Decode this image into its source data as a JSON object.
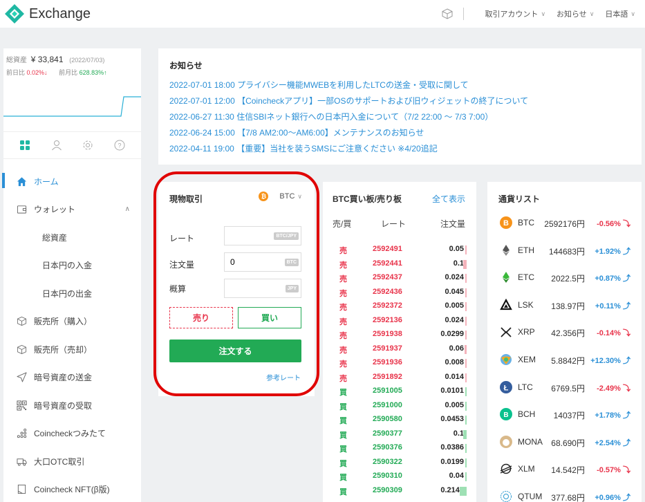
{
  "header": {
    "logo_text": "Exchange",
    "menus": [
      {
        "label": "取引アカウント"
      },
      {
        "label": "お知らせ"
      },
      {
        "label": "日本語"
      }
    ]
  },
  "sidebar": {
    "asset_label": "総資産",
    "asset_value": "¥ 33,841",
    "asset_date": "(2022/07/03)",
    "prev_day_label": "前日比",
    "prev_day_value": "0.02%↓",
    "prev_month_label": "前月比",
    "prev_month_value": "628.83%↑",
    "nav": [
      {
        "label": "ホーム",
        "icon": "home-icon"
      },
      {
        "label": "ウォレット",
        "icon": "wallet-icon"
      },
      {
        "label": "総資産"
      },
      {
        "label": "日本円の入金"
      },
      {
        "label": "日本円の出金"
      },
      {
        "label": "販売所（購入）",
        "icon": "cube-icon"
      },
      {
        "label": "販売所（売却）",
        "icon": "cube-icon"
      },
      {
        "label": "暗号資産の送金",
        "icon": "send-icon"
      },
      {
        "label": "暗号資産の受取",
        "icon": "qr-icon"
      },
      {
        "label": "Coincheckつみたて",
        "icon": "dots-icon"
      },
      {
        "label": "大口OTC取引",
        "icon": "truck-icon"
      },
      {
        "label": "Coincheck NFT(β版)",
        "icon": "nft-icon"
      }
    ]
  },
  "news": {
    "title": "お知らせ",
    "items": [
      "2022-07-01 18:00 プライバシー機能MWEBを利用したLTCの送金・受取に関して",
      "2022-07-01 12:00 【Coincheckアプリ】一部OSのサポートおよび旧ウィジェットの終了について",
      "2022-06-27 11:30 住信SBIネット銀行への日本円入金について（7/2 22:00 ～ 7/3 7:00）",
      "2022-06-24 15:00 【7/8 AM2:00～AM6:00】メンテナンスのお知らせ",
      "2022-04-11 19:00 【重要】当社を装うSMSにご注意ください ※4/20追記"
    ]
  },
  "trade": {
    "title": "現物取引",
    "coin": "BTC",
    "rate_label": "レート",
    "rate_unit": "BTC/JPY",
    "amount_label": "注文量",
    "amount_value": "0",
    "amount_unit": "BTC",
    "estimate_label": "概算",
    "estimate_unit": "JPY",
    "sell_label": "売り",
    "buy_label": "買い",
    "order_label": "注文する",
    "ref_label": "参考レート"
  },
  "book": {
    "title": "BTC買い板/売り板",
    "show_all": "全て表示",
    "col_side": "売/買",
    "col_rate": "レート",
    "col_amount": "注文量",
    "rows": [
      {
        "side": "売",
        "rate": "2592491",
        "amount": "0.05",
        "type": "ask"
      },
      {
        "side": "売",
        "rate": "2592441",
        "amount": "0.1",
        "type": "ask"
      },
      {
        "side": "売",
        "rate": "2592437",
        "amount": "0.024",
        "type": "ask"
      },
      {
        "side": "売",
        "rate": "2592436",
        "amount": "0.045",
        "type": "ask"
      },
      {
        "side": "売",
        "rate": "2592372",
        "amount": "0.005",
        "type": "ask"
      },
      {
        "side": "売",
        "rate": "2592136",
        "amount": "0.024",
        "type": "ask"
      },
      {
        "side": "売",
        "rate": "2591938",
        "amount": "0.0299",
        "type": "ask"
      },
      {
        "side": "売",
        "rate": "2591937",
        "amount": "0.06",
        "type": "ask"
      },
      {
        "side": "売",
        "rate": "2591936",
        "amount": "0.008",
        "type": "ask"
      },
      {
        "side": "売",
        "rate": "2591892",
        "amount": "0.014",
        "type": "ask"
      },
      {
        "side": "買",
        "rate": "2591005",
        "amount": "0.0101",
        "type": "bid"
      },
      {
        "side": "買",
        "rate": "2591000",
        "amount": "0.005",
        "type": "bid"
      },
      {
        "side": "買",
        "rate": "2590580",
        "amount": "0.0453",
        "type": "bid"
      },
      {
        "side": "買",
        "rate": "2590377",
        "amount": "0.1",
        "type": "bid"
      },
      {
        "side": "買",
        "rate": "2590376",
        "amount": "0.0386",
        "type": "bid"
      },
      {
        "side": "買",
        "rate": "2590322",
        "amount": "0.0199",
        "type": "bid"
      },
      {
        "side": "買",
        "rate": "2590310",
        "amount": "0.04",
        "type": "bid"
      },
      {
        "side": "買",
        "rate": "2590309",
        "amount": "0.2147",
        "type": "bid"
      }
    ]
  },
  "currencies": {
    "title": "通貨リスト",
    "items": [
      {
        "symbol": "BTC",
        "price": "2592176円",
        "change": "-0.56%",
        "dir": "down",
        "icon": "btc-icon"
      },
      {
        "symbol": "ETH",
        "price": "144683円",
        "change": "+1.92%",
        "dir": "up",
        "icon": "eth-icon"
      },
      {
        "symbol": "ETC",
        "price": "2022.5円",
        "change": "+0.87%",
        "dir": "up",
        "icon": "etc-icon"
      },
      {
        "symbol": "LSK",
        "price": "138.97円",
        "change": "+0.11%",
        "dir": "up",
        "icon": "lsk-icon"
      },
      {
        "symbol": "XRP",
        "price": "42.356円",
        "change": "-0.14%",
        "dir": "down",
        "icon": "xrp-icon"
      },
      {
        "symbol": "XEM",
        "price": "5.8842円",
        "change": "+12.30%",
        "dir": "up",
        "icon": "xem-icon"
      },
      {
        "symbol": "LTC",
        "price": "6769.5円",
        "change": "-2.49%",
        "dir": "down",
        "icon": "ltc-icon"
      },
      {
        "symbol": "BCH",
        "price": "14037円",
        "change": "+1.78%",
        "dir": "up",
        "icon": "bch-icon"
      },
      {
        "symbol": "MONA",
        "price": "68.690円",
        "change": "+2.54%",
        "dir": "up",
        "icon": "mona-icon"
      },
      {
        "symbol": "XLM",
        "price": "14.542円",
        "change": "-0.57%",
        "dir": "down",
        "icon": "xlm-icon"
      },
      {
        "symbol": "QTUM",
        "price": "377.68円",
        "change": "+0.96%",
        "dir": "up",
        "icon": "qtum-icon"
      }
    ]
  },
  "colors": {
    "accent_blue": "#2a8fd6",
    "buy_green": "#22aa55",
    "sell_red": "#e8334a",
    "logo_teal": "#1fb8a3",
    "highlight": "#e00000"
  }
}
